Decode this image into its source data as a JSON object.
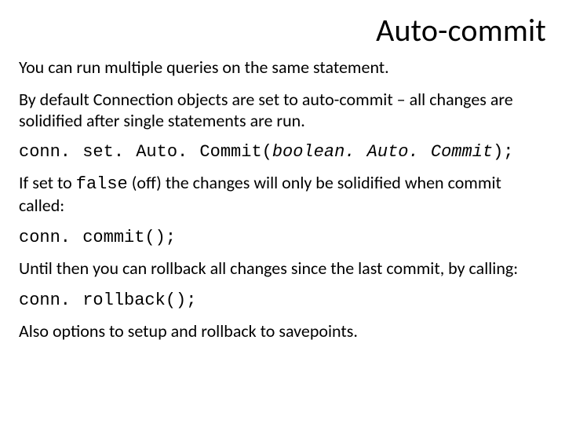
{
  "title": "Auto-commit",
  "p1": "You can run multiple queries on the same statement.",
  "p2": "By default Connection objects are set to auto-commit – all changes are solidified after single statements are run.",
  "code1_a": "conn. set. Auto. Commit(",
  "code1_b": "boolean. Auto. Commit",
  "code1_c": ");",
  "p3_a": "If set to ",
  "p3_b": "false",
  "p3_c": " (off) the changes will only be solidified when commit called:",
  "code2": "conn. commit();",
  "p4": "Until then you can rollback all changes since the last commit, by calling:",
  "code3": "conn. rollback();",
  "p5": "Also options to setup and rollback to savepoints."
}
